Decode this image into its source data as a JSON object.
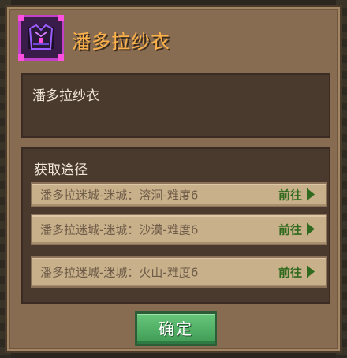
{
  "item": {
    "icon": "robe-armor-icon",
    "title": "潘多拉纱衣",
    "description": "潘多拉纱衣"
  },
  "sources": {
    "heading": "获取途径",
    "goto_label": "前往",
    "routes": [
      {
        "label": "潘多拉迷城-迷城：溶洞-难度6"
      },
      {
        "label": "潘多拉迷城-迷城：沙漠-难度6"
      },
      {
        "label": "潘多拉迷城-迷城：火山-难度6"
      }
    ]
  },
  "confirm_label": "确定",
  "colors": {
    "title": "#ffb24a",
    "goto": "#2f6a1e",
    "confirm_button": "#4fae63"
  }
}
